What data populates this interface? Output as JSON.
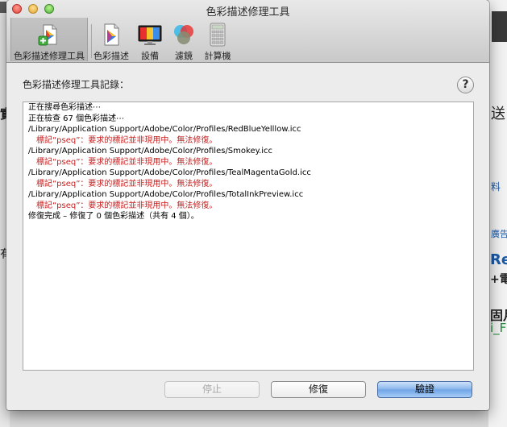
{
  "window": {
    "title": "色彩描述修理工具"
  },
  "toolbar": {
    "items": [
      {
        "label": "色彩描述修理工具",
        "icon": "repair-tool-icon",
        "selected": true
      },
      {
        "label": "色彩描述",
        "icon": "color-profile-icon",
        "selected": false
      },
      {
        "label": "設備",
        "icon": "display-icon",
        "selected": false
      },
      {
        "label": "濾鏡",
        "icon": "color-filter-icon",
        "selected": false
      },
      {
        "label": "計算機",
        "icon": "calculator-icon",
        "selected": false
      }
    ]
  },
  "log_section": {
    "label": "色彩描述修理工具記錄：",
    "help": "?",
    "lines": [
      {
        "text": "正在搜尋色彩描述⋯",
        "type": "info"
      },
      {
        "text": "正在檢查 67 個色彩描述⋯",
        "type": "info"
      },
      {
        "text": "/Library/Application Support/Adobe/Color/Profiles/RedBlueYelllow.icc",
        "type": "path"
      },
      {
        "text": "標記“pseq”：要求的標記並非現用中。無法修復。",
        "type": "error"
      },
      {
        "text": "/Library/Application Support/Adobe/Color/Profiles/Smokey.icc",
        "type": "path"
      },
      {
        "text": "標記“pseq”：要求的標記並非現用中。無法修復。",
        "type": "error"
      },
      {
        "text": "/Library/Application Support/Adobe/Color/Profiles/TealMagentaGold.icc",
        "type": "path"
      },
      {
        "text": "標記“pseq”：要求的標記並非現用中。無法修復。",
        "type": "error"
      },
      {
        "text": "/Library/Application Support/Adobe/Color/Profiles/TotalInkPreview.icc",
        "type": "path"
      },
      {
        "text": "標記“pseq”：要求的標記並非現用中。無法修復。",
        "type": "error"
      },
      {
        "text": "修復完成 – 修復了 0 個色彩描述（共有 4 個）。",
        "type": "info"
      }
    ]
  },
  "buttons": {
    "stop": "停止",
    "repair": "修復",
    "verify": "驗證"
  },
  "background_app": {
    "right_texts": [
      "送",
      "料",
      "廣告",
      "Reg",
      "+電",
      "固月",
      "i_F"
    ],
    "left_texts": [
      "實",
      "有"
    ]
  },
  "colors": {
    "error_text": "#c81e1e",
    "default_button": "#6ea3e6",
    "background_link": "#1a5aa8",
    "background_green": "#1f8a3a"
  }
}
